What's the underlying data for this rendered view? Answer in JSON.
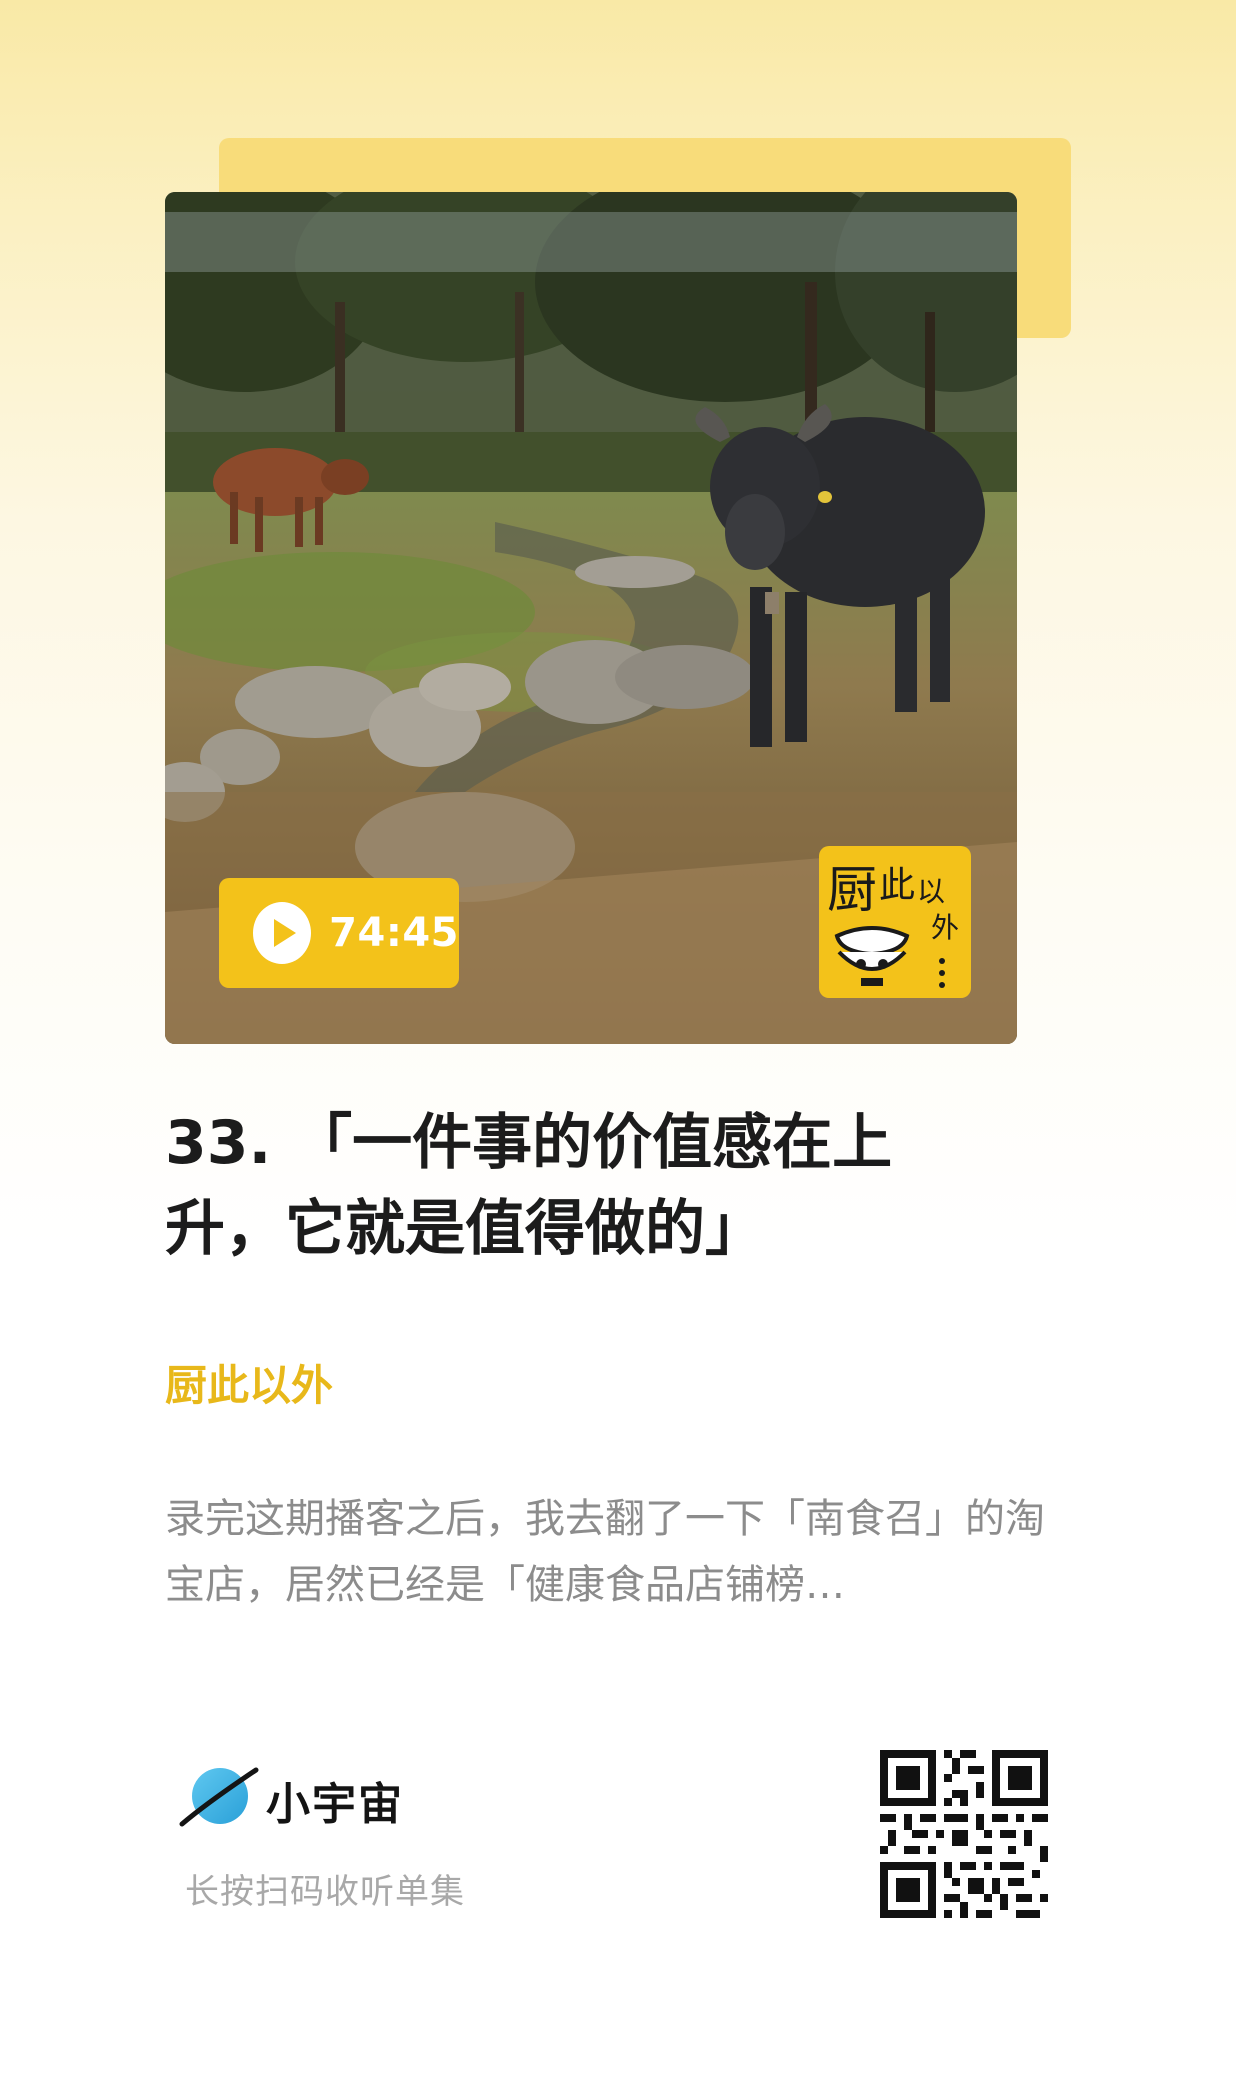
{
  "cover": {
    "duration": "74:45",
    "play_icon": "play-icon",
    "sticker_chars": [
      "厨",
      "此",
      "以",
      "外"
    ]
  },
  "episode": {
    "title": "33. 「一件事的价值感在上升，它就是值得做的」",
    "podcast_name": "厨此以外",
    "description": "录完这期播客之后，我去翻了一下「南食召」的淘宝店，居然已经是「健康食品店铺榜…"
  },
  "footer": {
    "app_name": "小宇宙",
    "app_icon": "planet-icon",
    "scan_hint": "长按扫码收听单集",
    "qr_icon": "qr-code-icon"
  },
  "colors": {
    "accent": "#f3c21a",
    "podcast_name": "#e8b81a",
    "card_back": "#f8dc7a"
  }
}
